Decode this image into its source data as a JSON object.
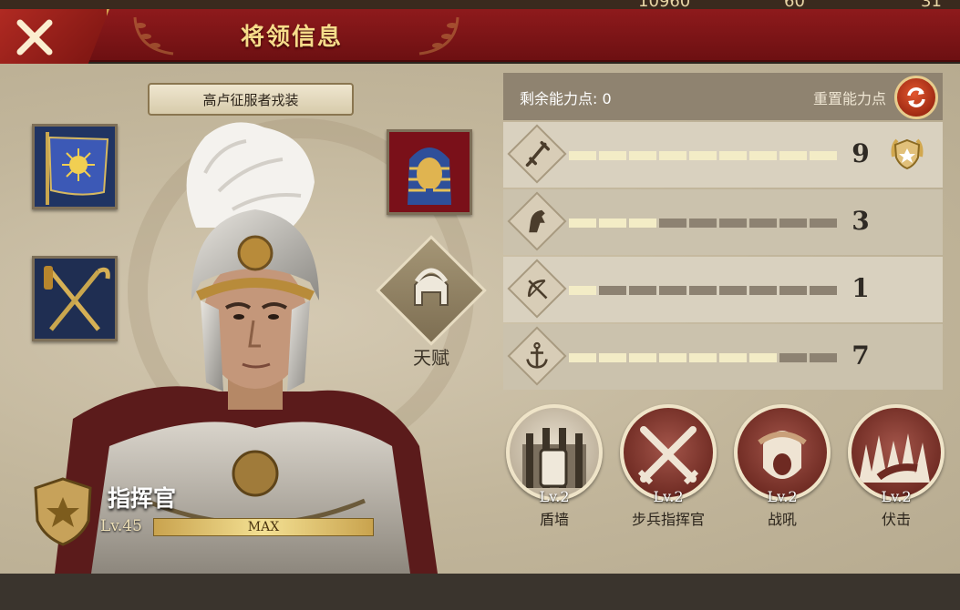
{
  "header": {
    "title": "将领信息",
    "resources": [
      "10960",
      "60",
      "31"
    ]
  },
  "equipment": {
    "set_name": "高卢征服者戎装",
    "slots": [
      "banner-slot",
      "staffs-slot",
      "pharaoh-mask-slot"
    ]
  },
  "talent": {
    "label": "天赋"
  },
  "commander": {
    "rank_title": "指挥官",
    "level_label": "Lv.45",
    "progress_label": "MAX",
    "progress_fraction": 1.0
  },
  "stats": {
    "remaining_label": "剩余能力点:",
    "remaining_value": "0",
    "reset_label": "重置能力点",
    "max_points": 9,
    "rows": [
      {
        "icon": "sword-icon",
        "value": "9",
        "points": 9,
        "medal": true
      },
      {
        "icon": "horse-icon",
        "value": "3",
        "points": 3,
        "medal": false
      },
      {
        "icon": "bow-icon",
        "value": "1",
        "points": 1,
        "medal": false
      },
      {
        "icon": "anchor-icon",
        "value": "7",
        "points": 7,
        "medal": false
      }
    ]
  },
  "skills": [
    {
      "name": "盾墙",
      "level": "Lv.2",
      "icon": "shield-wall-icon"
    },
    {
      "name": "步兵指挥官",
      "level": "Lv.2",
      "icon": "crossed-swords-icon"
    },
    {
      "name": "战吼",
      "level": "Lv.2",
      "icon": "war-cry-icon"
    },
    {
      "name": "伏击",
      "level": "Lv.2",
      "icon": "ambush-icon"
    }
  ],
  "colors": {
    "title_bar": "#8e1a1c",
    "title_text": "#f6dc8a",
    "bar_on": "#f3ecc6",
    "bar_off": "#8d8272",
    "reset_button": "#c2401f"
  }
}
